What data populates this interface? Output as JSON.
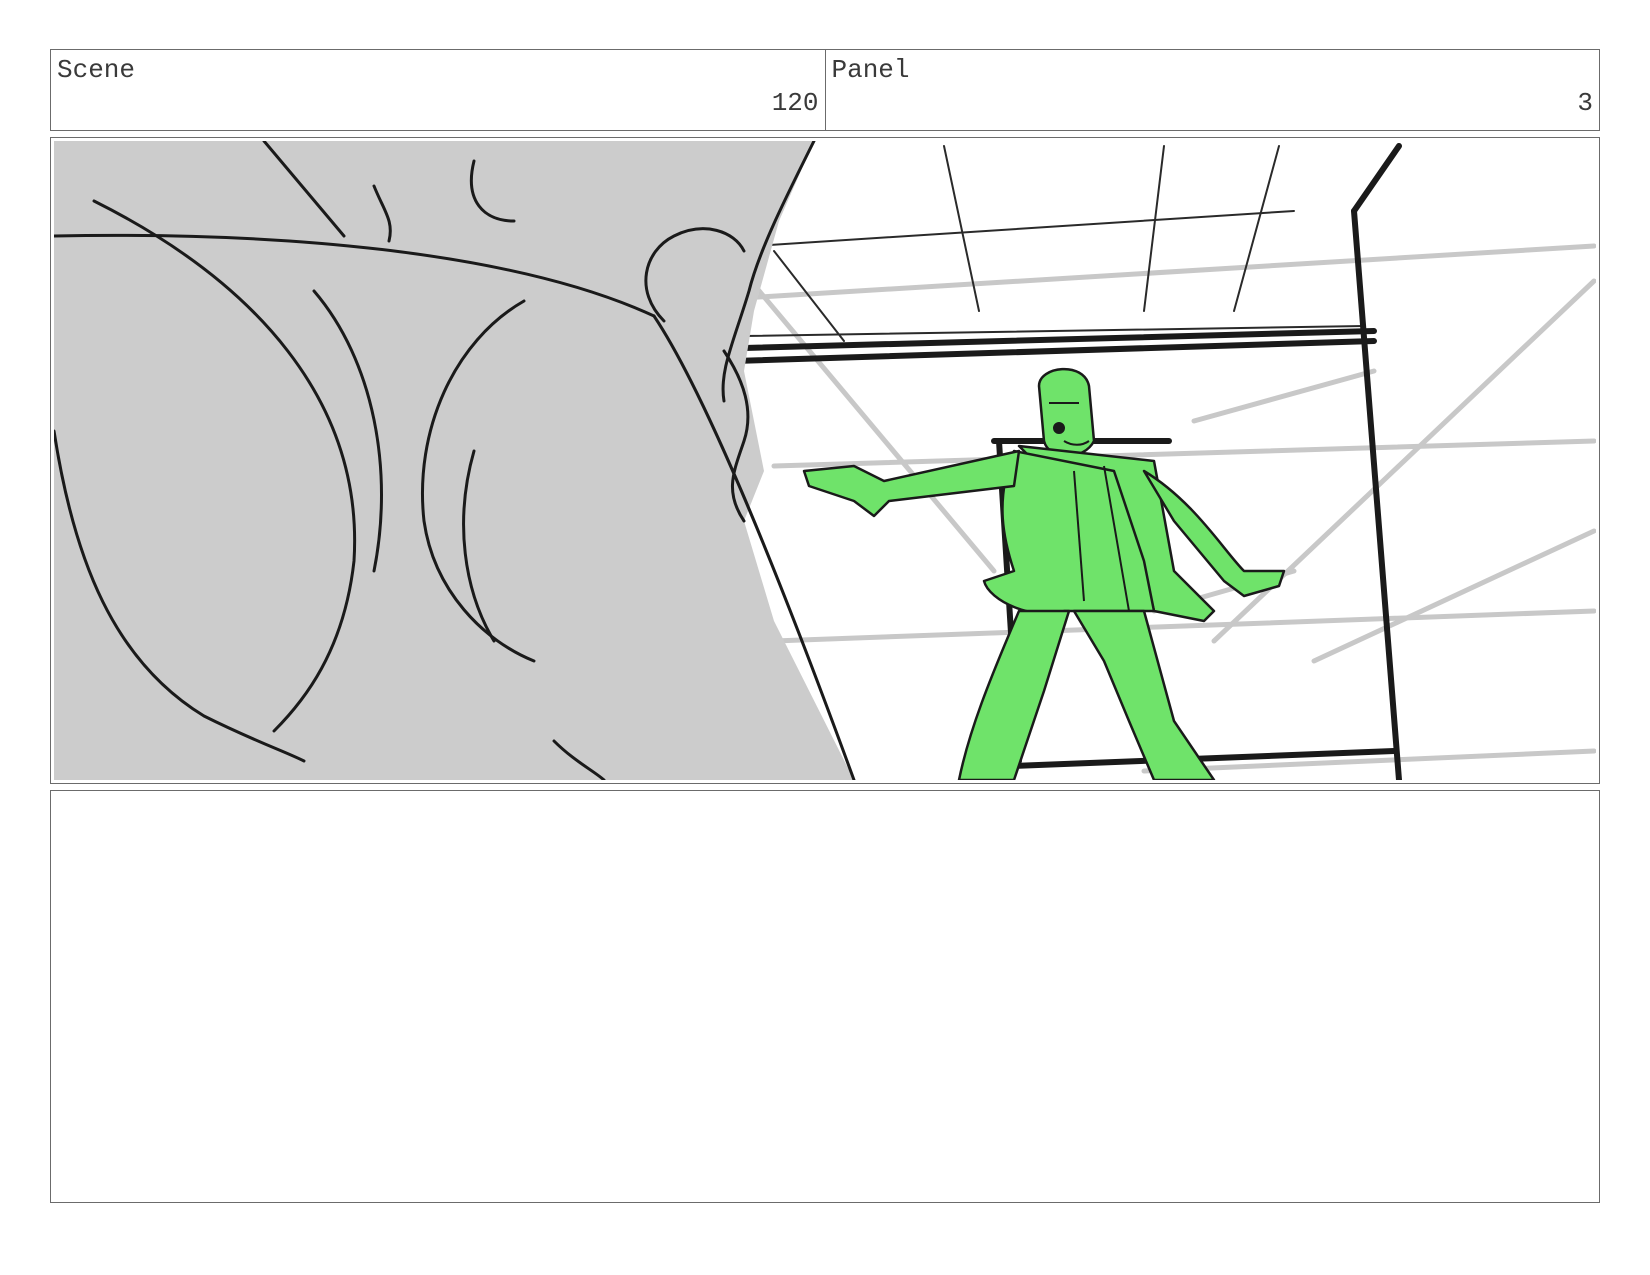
{
  "header": {
    "scene_label": "Scene",
    "scene_number": "120",
    "panel_label": "Panel",
    "panel_number": "3"
  },
  "panel_image": {
    "subject_color": "#6fe36a",
    "foreground_color": "#cccccc",
    "line_color": "#1a1a1a"
  },
  "notes": {
    "text": ""
  }
}
